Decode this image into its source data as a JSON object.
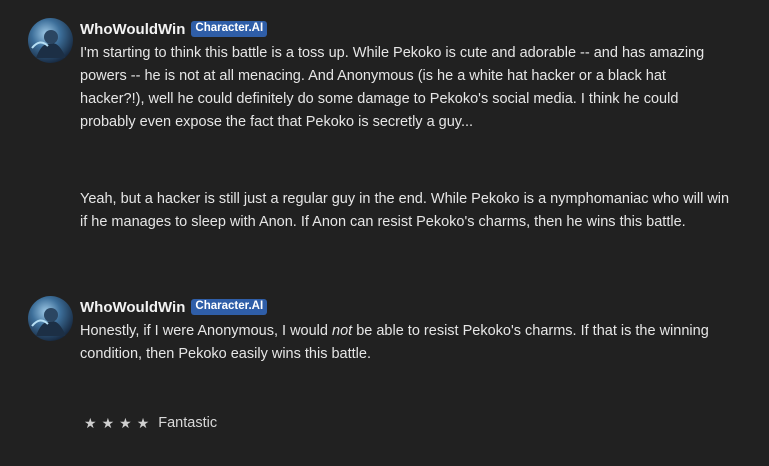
{
  "messages": [
    {
      "author": "WhoWouldWin",
      "badge": "Character.AI",
      "text": "I'm starting to think this battle is a toss up. While Pekoko is cute and adorable -- and has amazing powers -- he is not at all menacing. And Anonymous (is he a white hat hacker or a black hat hacker?!), well he could definitely do some damage to Pekoko's social media. I think he could probably even expose the fact that Pekoko is secretly a guy..."
    },
    {
      "text": "Yeah, but a hacker is still just a regular guy in the end. While Pekoko is a nymphomaniac who will win if he manages to sleep with Anon. If Anon can resist Pekoko's charms, then he  wins this battle."
    },
    {
      "author": "WhoWouldWin",
      "badge": "Character.AI",
      "text_before": "Honestly, if I were Anonymous, I would ",
      "text_emphasis": "not",
      "text_after": " be able to resist Pekoko's charms. If that is the winning condition, then Pekoko easily wins this battle."
    }
  ],
  "rating": {
    "stars": 4,
    "star_glyph": "★",
    "label": "Fantastic"
  }
}
